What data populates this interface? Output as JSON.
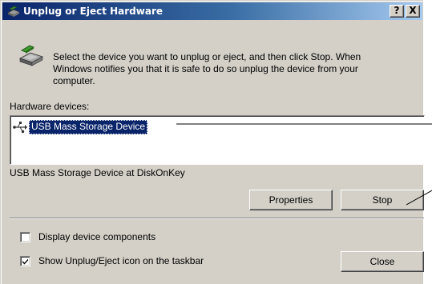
{
  "window": {
    "title": "Unplug or Eject Hardware",
    "help_button": "?",
    "close_button": "X"
  },
  "instructions": "Select the device you want to unplug or eject, and then click Stop. When\nWindows notifies you that it is safe to do so unplug the device from your\ncomputer.",
  "hardware_devices_label": "Hardware devices:",
  "devices": [
    {
      "name": "USB Mass Storage Device",
      "icon": "usb-device-icon",
      "selected": true
    }
  ],
  "selected_device_description": "USB Mass Storage Device at DiskOnKey",
  "buttons": {
    "properties": "Properties",
    "stop": "Stop",
    "close": "Close"
  },
  "checkboxes": {
    "display_components": {
      "label": "Display device components",
      "checked": false
    },
    "show_icon": {
      "label": "Show Unplug/Eject icon on the taskbar",
      "checked": true
    }
  },
  "colors": {
    "title_gradient_start": "#0a246a",
    "title_gradient_end": "#a6caf0",
    "dialog_face": "#d4d0c8",
    "selection": "#0a246a"
  }
}
